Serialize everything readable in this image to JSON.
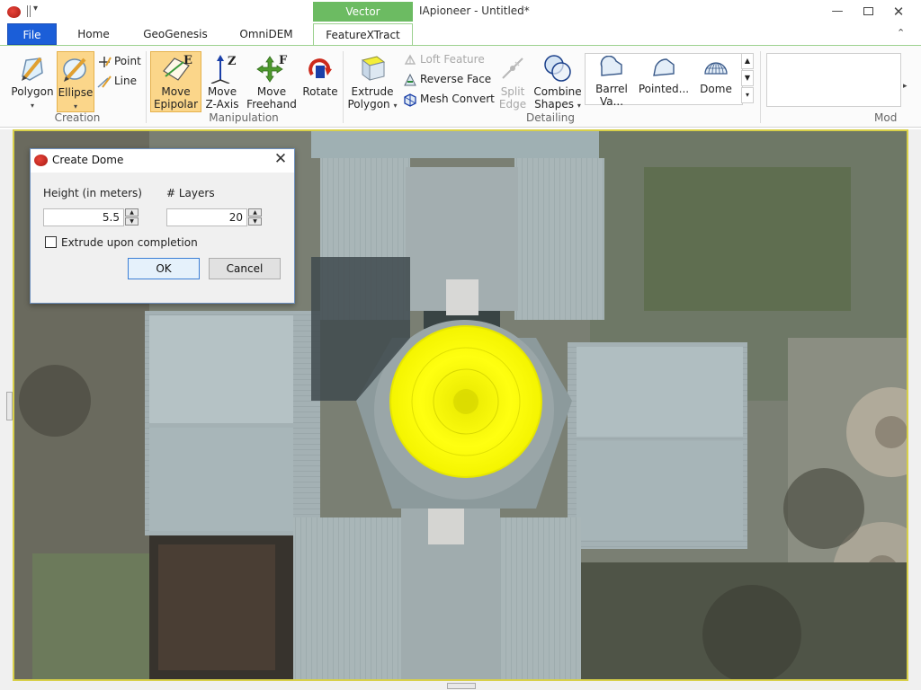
{
  "window": {
    "title": "IApioneer - Untitled*",
    "context_tab_group": "Vector",
    "min_symbol": "—",
    "close_symbol": "✕",
    "collapse_symbol": "⌃"
  },
  "menu": {
    "tabs": [
      {
        "label": "File"
      },
      {
        "label": "Home"
      },
      {
        "label": "GeoGenesis"
      },
      {
        "label": "OmniDEM"
      },
      {
        "label": "FeatureXTract"
      }
    ],
    "active_tab": "FeatureXTract"
  },
  "ribbon": {
    "groups": {
      "creation": {
        "label": "Creation",
        "polygon": "Polygon",
        "ellipse": "Ellipse",
        "point": "Point",
        "line": "Line",
        "selected": "Ellipse"
      },
      "manipulation": {
        "label": "Manipulation",
        "move_epipolar": [
          "Move",
          "Epipolar"
        ],
        "move_z": [
          "Move",
          "Z-Axis"
        ],
        "move_freehand": [
          "Move",
          "Freehand"
        ],
        "rotate": "Rotate",
        "selected": "Move Epipolar"
      },
      "detailing": {
        "label": "Detailing",
        "extrude_polygon": [
          "Extrude",
          "Polygon"
        ],
        "loft_feature": "Loft Feature",
        "reverse_face": "Reverse Face",
        "mesh_convert": "Mesh Convert",
        "split_edge": [
          "Split",
          "Edge"
        ],
        "combine_shapes": [
          "Combine",
          "Shapes"
        ]
      },
      "shapes_gallery": {
        "items": [
          "Barrel Va...",
          "Pointed...",
          "Dome"
        ]
      },
      "mod": {
        "label": "Mod"
      }
    },
    "icon_letters": {
      "epipolar": "E",
      "z_axis": "Z",
      "freehand": "F"
    },
    "colors": {
      "selected_bg": "#fbd68a",
      "context_tab": "#6cbb62",
      "file_tab": "#1b5ed8"
    }
  },
  "dialog": {
    "title": "Create Dome",
    "height_label": "Height (in meters)",
    "height_value": "5.5",
    "layers_label": "# Layers",
    "layers_value": "20",
    "extrude_label": "Extrude upon completion",
    "extrude_checked": false,
    "ok_label": "OK",
    "cancel_label": "Cancel",
    "close_symbol": "✕"
  },
  "viewport": {
    "content": "aerial imagery",
    "dome_highlight_color": "#ffff00"
  }
}
